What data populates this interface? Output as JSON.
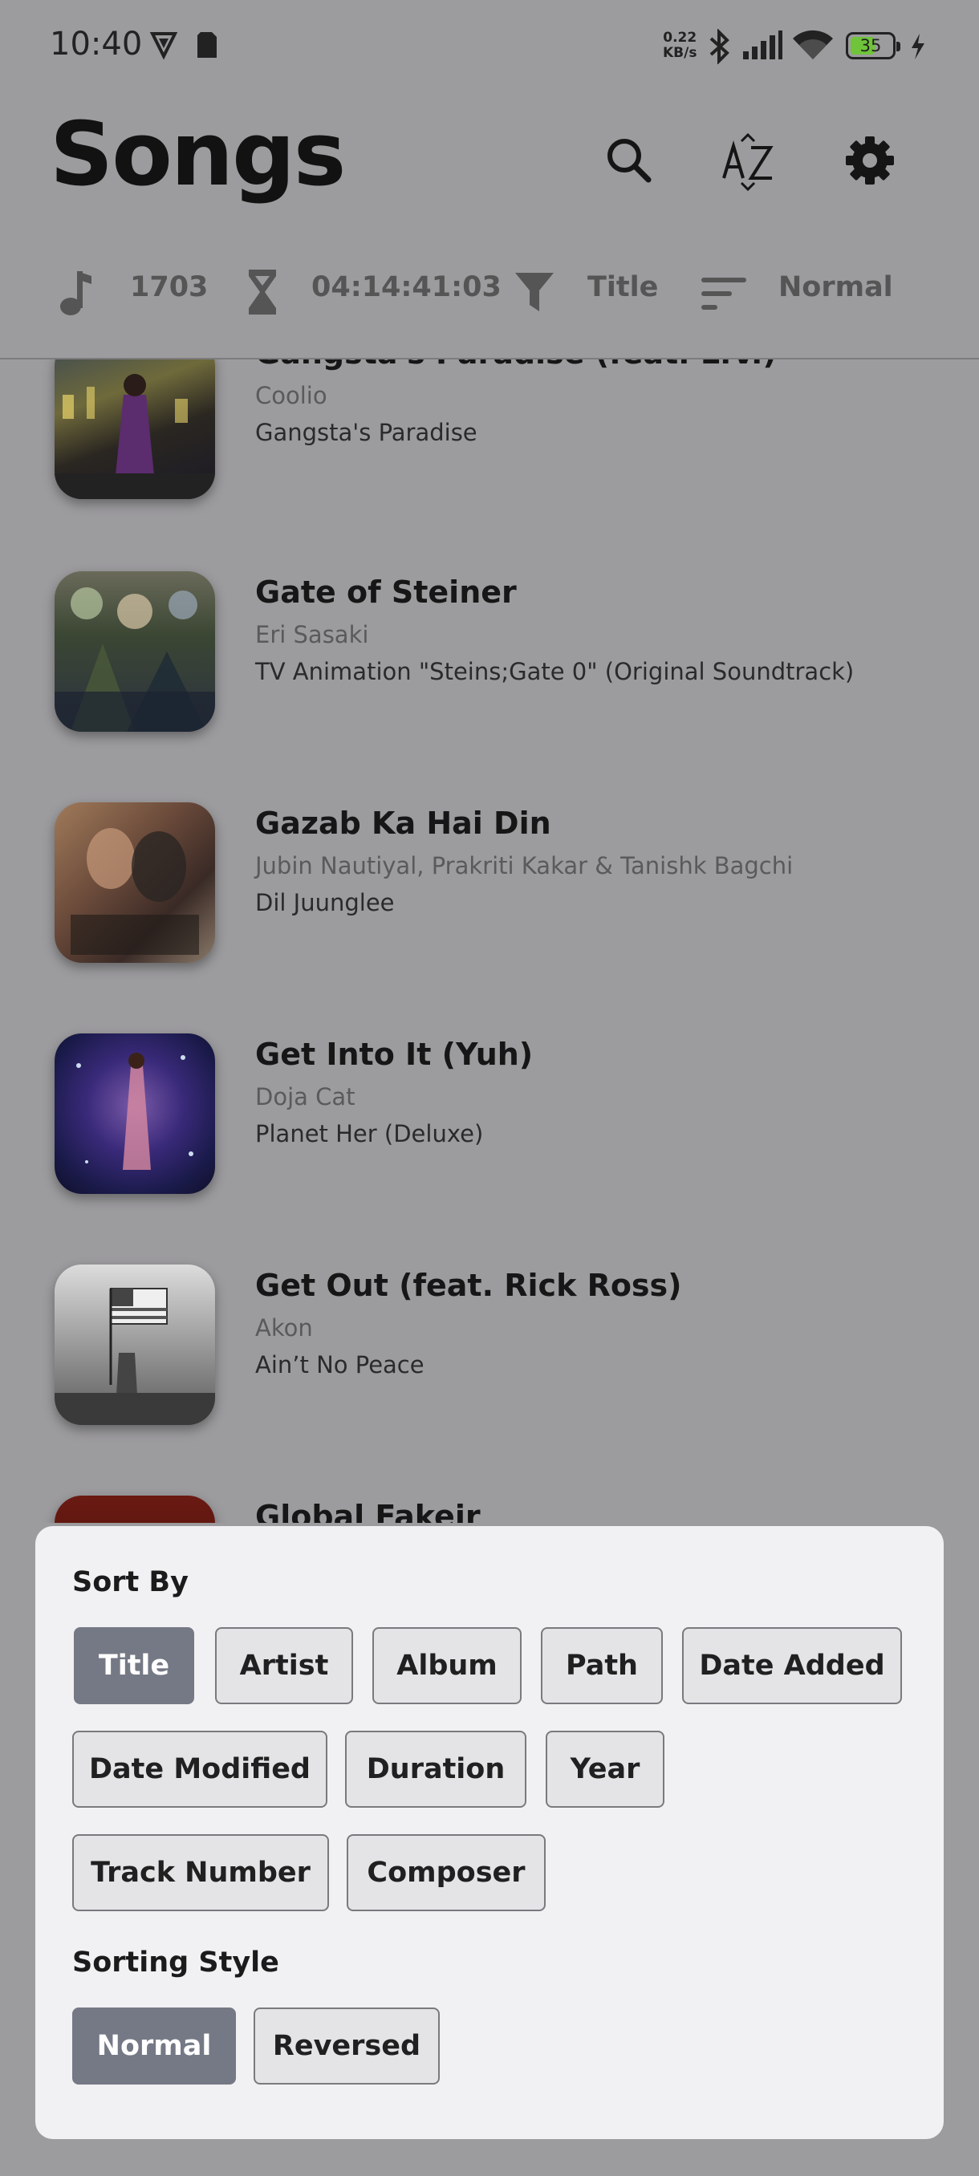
{
  "status_bar": {
    "time": "10:40",
    "net_speed_value": "0.22",
    "net_speed_unit": "KB/s",
    "battery": "35"
  },
  "header": {
    "title": "Songs",
    "icons": [
      "search-icon",
      "sort-az-icon",
      "settings-gear-icon"
    ]
  },
  "stats": {
    "song_count": "1703",
    "total_duration": "04:14:41:03",
    "filter": "Title",
    "sort_order": "Normal"
  },
  "songs": [
    {
      "title": "Gangsta's Paradise (feat. L.V.)",
      "artist": "Coolio",
      "album": "Gangsta's Paradise"
    },
    {
      "title": "Gate of Steiner",
      "artist": "Eri Sasaki",
      "album": "TV Animation \"Steins;Gate 0\" (Original Soundtrack)"
    },
    {
      "title": "Gazab Ka Hai Din",
      "artist": "Jubin Nautiyal, Prakriti Kakar & Tanishk Bagchi",
      "album": "Dil Juunglee"
    },
    {
      "title": "Get Into It (Yuh)",
      "artist": "Doja Cat",
      "album": "Planet Her (Deluxe)"
    },
    {
      "title": "Get Out (feat. Rick Ross)",
      "artist": "Akon",
      "album": "Ain’t No Peace"
    },
    {
      "title": "Global Fakeir",
      "artist": "",
      "album": ""
    }
  ],
  "sort_sheet": {
    "sort_by_label": "Sort By",
    "sort_by_options": [
      "Title",
      "Artist",
      "Album",
      "Path",
      "Date Added",
      "Date Modified",
      "Duration",
      "Year",
      "Track Number",
      "Composer"
    ],
    "sort_by_selected": "Title",
    "sorting_style_label": "Sorting Style",
    "sorting_style_options": [
      "Normal",
      "Reversed"
    ],
    "sorting_style_selected": "Normal"
  },
  "colors": {
    "scrim_background": "#9c9b9e",
    "sheet_background": "#f1f0f2",
    "chip_selected": "#757985",
    "chip_unselected": "#e4e3e6",
    "battery_fill": "#6fc43a"
  }
}
